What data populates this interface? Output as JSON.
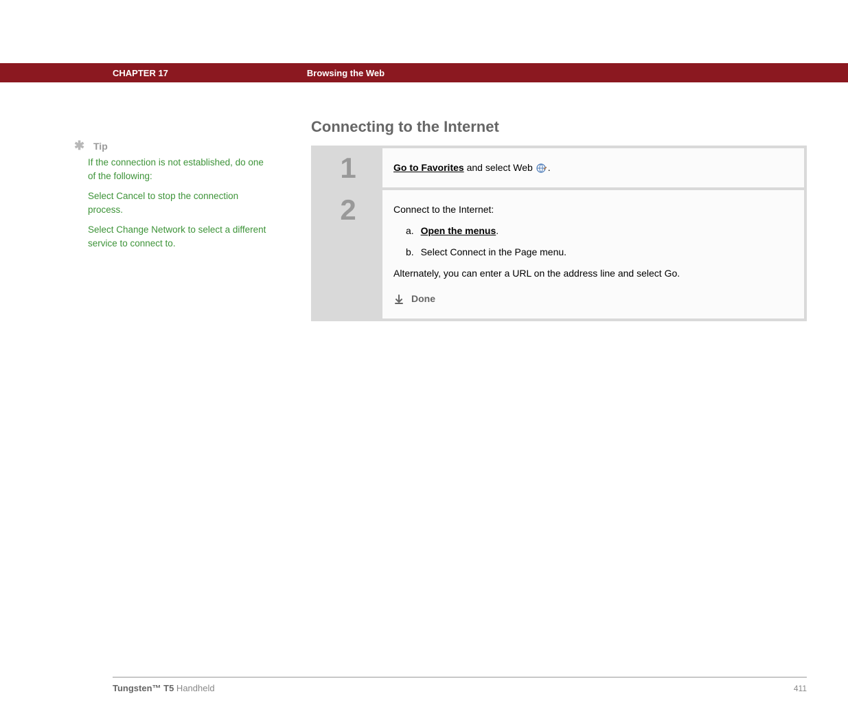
{
  "header": {
    "chapter": "CHAPTER 17",
    "title": "Browsing the Web"
  },
  "sidebar": {
    "tip_label": "Tip",
    "tip_intro": "If the connection is not established, do one of the following:",
    "tip_option1": "Select Cancel to stop the connection process.",
    "tip_option2": "Select Change Network to select a different service to connect to."
  },
  "main": {
    "section_title": "Connecting to the Internet",
    "steps": [
      {
        "number": "1",
        "link_text": "Go to Favorites",
        "rest_text": " and select Web ",
        "period": "."
      },
      {
        "number": "2",
        "intro": "Connect to the Internet:",
        "sub_a_letter": "a.",
        "sub_a_link": "Open the menus",
        "sub_a_period": ".",
        "sub_b_letter": "b.",
        "sub_b_text": "Select Connect in the Page menu.",
        "alt_text": "Alternately, you can enter a URL on the address line and select Go.",
        "done_label": "Done"
      }
    ]
  },
  "footer": {
    "product_bold": "Tungsten™ T5",
    "product_rest": " Handheld",
    "page_number": "411"
  }
}
